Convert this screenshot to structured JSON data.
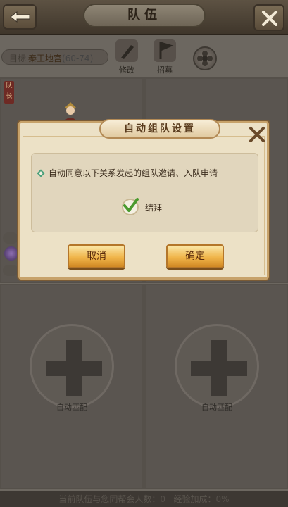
{
  "header": {
    "title": "队伍"
  },
  "destination": {
    "label": "目标",
    "value": "秦王地宫",
    "level": "(60-74)"
  },
  "toolbar": {
    "edit_label": "修改",
    "recruit_label": "招募"
  },
  "leader_tag": "队长",
  "slots": {
    "match_label_left": "自动匹配",
    "match_label_right": "自动匹配"
  },
  "footer": {
    "text": "当前队伍与您同帮会人数：",
    "count": "0",
    "exp_label": "经验加成：",
    "exp_value": "0%"
  },
  "dialog": {
    "title": "自动组队设置",
    "description": "自动同意以下关系发起的组队邀请、入队申请",
    "option_label": "结拜",
    "option_checked": true,
    "cancel_label": "取消",
    "confirm_label": "确定"
  },
  "colors": {
    "dialog_bg": "#ece1c6",
    "button_gold": "#f0b54a",
    "check_green": "#4a9a2e"
  }
}
